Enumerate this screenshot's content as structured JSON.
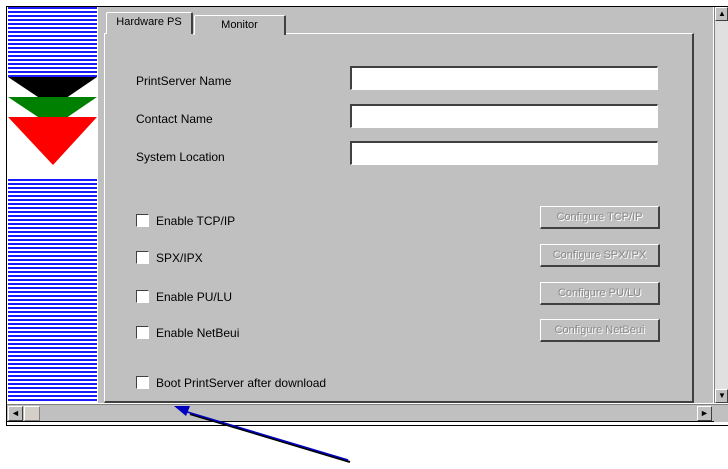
{
  "tabs": {
    "hardware_ps": "Hardware PS",
    "monitor": "Monitor"
  },
  "fields": {
    "printserver_name": {
      "label": "PrintServer Name",
      "value": ""
    },
    "contact_name": {
      "label": "Contact Name",
      "value": ""
    },
    "system_location": {
      "label": "System Location",
      "value": ""
    }
  },
  "protocols": [
    {
      "label": "Enable TCP/IP",
      "checked": false,
      "button": "Configure TCP/IP"
    },
    {
      "label": "SPX/IPX",
      "checked": false,
      "button": "Configure SPX/IPX"
    },
    {
      "label": "Enable PU/LU",
      "checked": false,
      "button": "Configure PU/LU"
    },
    {
      "label": "Enable NetBeui",
      "checked": false,
      "button": "Configure NetBeui"
    }
  ],
  "boot_option": {
    "label": "Boot PrintServer after download",
    "checked": false
  },
  "scrollbars": {
    "left_arrow": "◄",
    "right_arrow": "►",
    "up_arrow": "▲",
    "down_arrow": "▼"
  },
  "colors": {
    "face": "#c0c0c0",
    "stripe_blue": "#1a1aff",
    "logo_black": "#000000",
    "logo_green": "#008000",
    "logo_red": "#ff0000",
    "callout_arrow": "#0000c0"
  }
}
